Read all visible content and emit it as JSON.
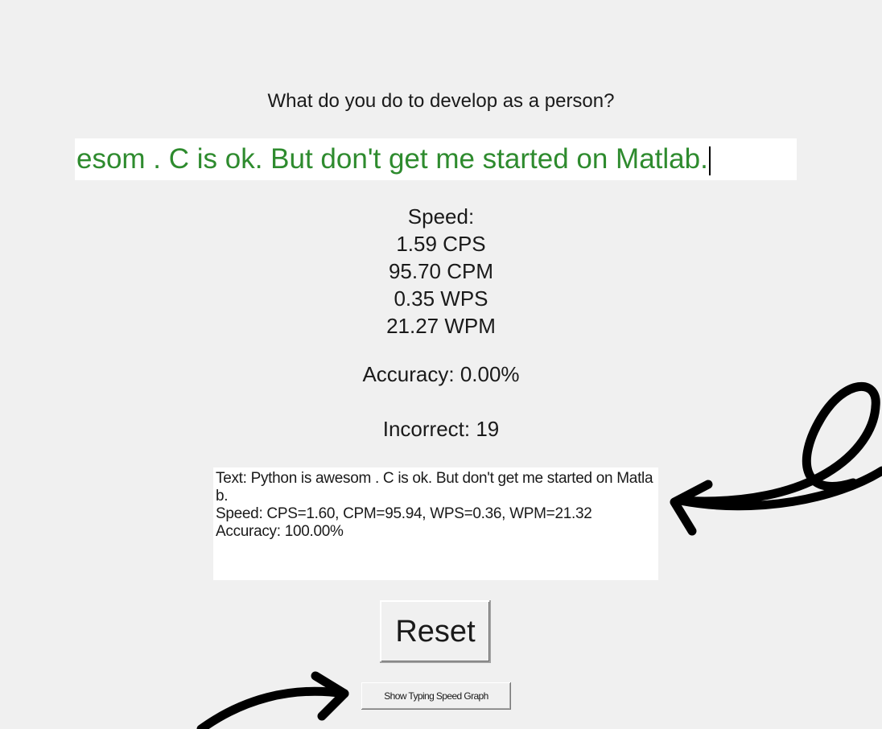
{
  "prompt": "What do you do to develop as a person?",
  "entry": {
    "value": "esom . C is ok. But don't get me started on Matlab."
  },
  "stats": {
    "speed_label": "Speed:",
    "cps": "1.59 CPS",
    "cpm": "95.70 CPM",
    "wps": "0.35 WPS",
    "wpm": "21.27 WPM",
    "accuracy": "Accuracy: 0.00%",
    "incorrect": "Incorrect: 19"
  },
  "log": {
    "text": "Text: Python is awesom . C is ok. But don't get me started on Matlab.\nSpeed: CPS=1.60, CPM=95.94, WPS=0.36, WPM=21.32\nAccuracy: 100.00%"
  },
  "buttons": {
    "reset_label": "Reset",
    "graph_label": "Show Typing Speed Graph"
  },
  "colors": {
    "typed_text": "#2e8b2e",
    "background": "#f0f0f0",
    "annotation": "#000000"
  }
}
